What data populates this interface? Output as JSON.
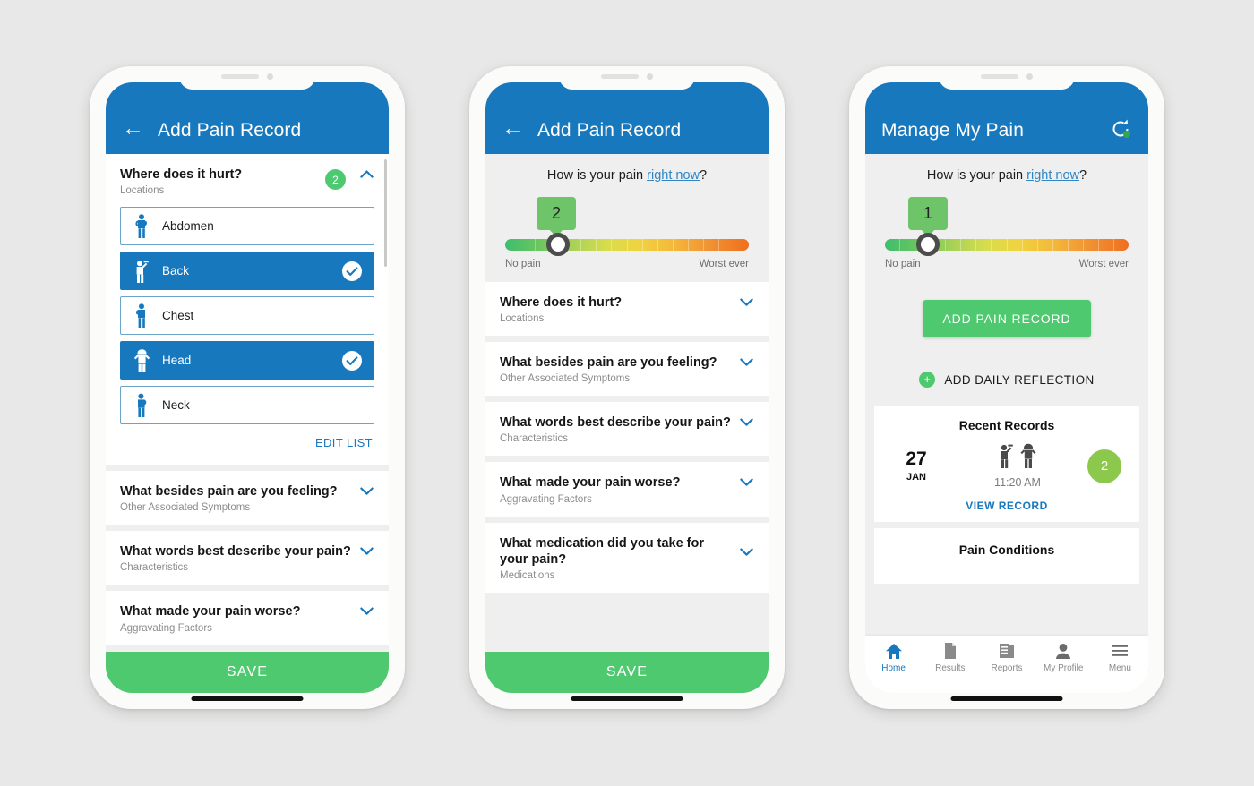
{
  "colors": {
    "brand_blue": "#1878be",
    "green": "#4ec96f",
    "bubble_green": "#6ec469",
    "score_green": "#8cc84b",
    "page_bg": "#e8e8e8",
    "screen_bg": "#efefef"
  },
  "phone1": {
    "appbar": {
      "back_icon": "arrow-left-icon",
      "title": "Add Pain Record"
    },
    "sections": [
      {
        "question": "Where does it hurt?",
        "subtitle": "Locations",
        "badge": "2",
        "chevron": "chevron-up-icon",
        "expanded": true,
        "options": [
          {
            "label": "Abdomen",
            "icon": "body-abdomen-icon",
            "selected": false
          },
          {
            "label": "Back",
            "icon": "body-back-icon",
            "selected": true
          },
          {
            "label": "Chest",
            "icon": "body-chest-icon",
            "selected": false
          },
          {
            "label": "Head",
            "icon": "body-head-icon",
            "selected": true
          },
          {
            "label": "Neck",
            "icon": "body-neck-icon",
            "selected": false
          }
        ],
        "edit_list_label": "EDIT LIST"
      },
      {
        "question": "What besides pain are you feeling?",
        "subtitle": "Other Associated Symptoms",
        "chevron": "chevron-down-icon",
        "expanded": false
      },
      {
        "question": "What words best describe your pain?",
        "subtitle": "Characteristics",
        "chevron": "chevron-down-icon",
        "expanded": false
      },
      {
        "question": "What made your pain worse?",
        "subtitle": "Aggravating Factors",
        "chevron": "chevron-down-icon",
        "expanded": false
      }
    ],
    "save_label": "SAVE"
  },
  "phone2": {
    "appbar": {
      "back_icon": "arrow-left-icon",
      "title": "Add Pain Record"
    },
    "pain": {
      "question_prefix": "How is your pain ",
      "question_link": "right now",
      "question_suffix": "?",
      "value": "2",
      "min_label": "No pain",
      "max_label": "Worst ever",
      "min": 0,
      "max": 10,
      "percent": 20
    },
    "sections": [
      {
        "question": "Where does it hurt?",
        "subtitle": "Locations",
        "chevron": "chevron-down-icon"
      },
      {
        "question": "What besides pain are you feeling?",
        "subtitle": "Other Associated Symptoms",
        "chevron": "chevron-down-icon"
      },
      {
        "question": "What words best describe your pain?",
        "subtitle": "Characteristics",
        "chevron": "chevron-down-icon"
      },
      {
        "question": "What made your pain worse?",
        "subtitle": "Aggravating Factors",
        "chevron": "chevron-down-icon"
      },
      {
        "question": "What medication did you take for your pain?",
        "subtitle": "Medications",
        "chevron": "chevron-down-icon"
      }
    ],
    "save_label": "SAVE"
  },
  "phone3": {
    "appbar": {
      "title": "Manage My Pain",
      "sync_icon": "sync-icon"
    },
    "pain": {
      "question_prefix": "How is your pain ",
      "question_link": "right now",
      "question_suffix": "?",
      "value": "1",
      "min_label": "No pain",
      "max_label": "Worst ever",
      "min": 0,
      "max": 10,
      "percent": 10
    },
    "add_pain_record_label": "ADD PAIN RECORD",
    "add_daily_reflection_label": "ADD DAILY REFLECTION",
    "recent_records": {
      "title": "Recent Records",
      "day": "27",
      "month": "JAN",
      "time": "11:20 AM",
      "score": "2",
      "icons": [
        "body-back-icon-dark",
        "body-head-icon-dark"
      ],
      "view_record_label": "VIEW RECORD"
    },
    "pain_conditions": {
      "title": "Pain Conditions"
    },
    "bottom_nav": [
      {
        "label": "Home",
        "icon": "home-icon",
        "active": true
      },
      {
        "label": "Results",
        "icon": "document-icon",
        "active": false
      },
      {
        "label": "Reports",
        "icon": "report-icon",
        "active": false
      },
      {
        "label": "My Profile",
        "icon": "person-icon",
        "active": false
      },
      {
        "label": "Menu",
        "icon": "hamburger-icon",
        "active": false
      }
    ]
  }
}
